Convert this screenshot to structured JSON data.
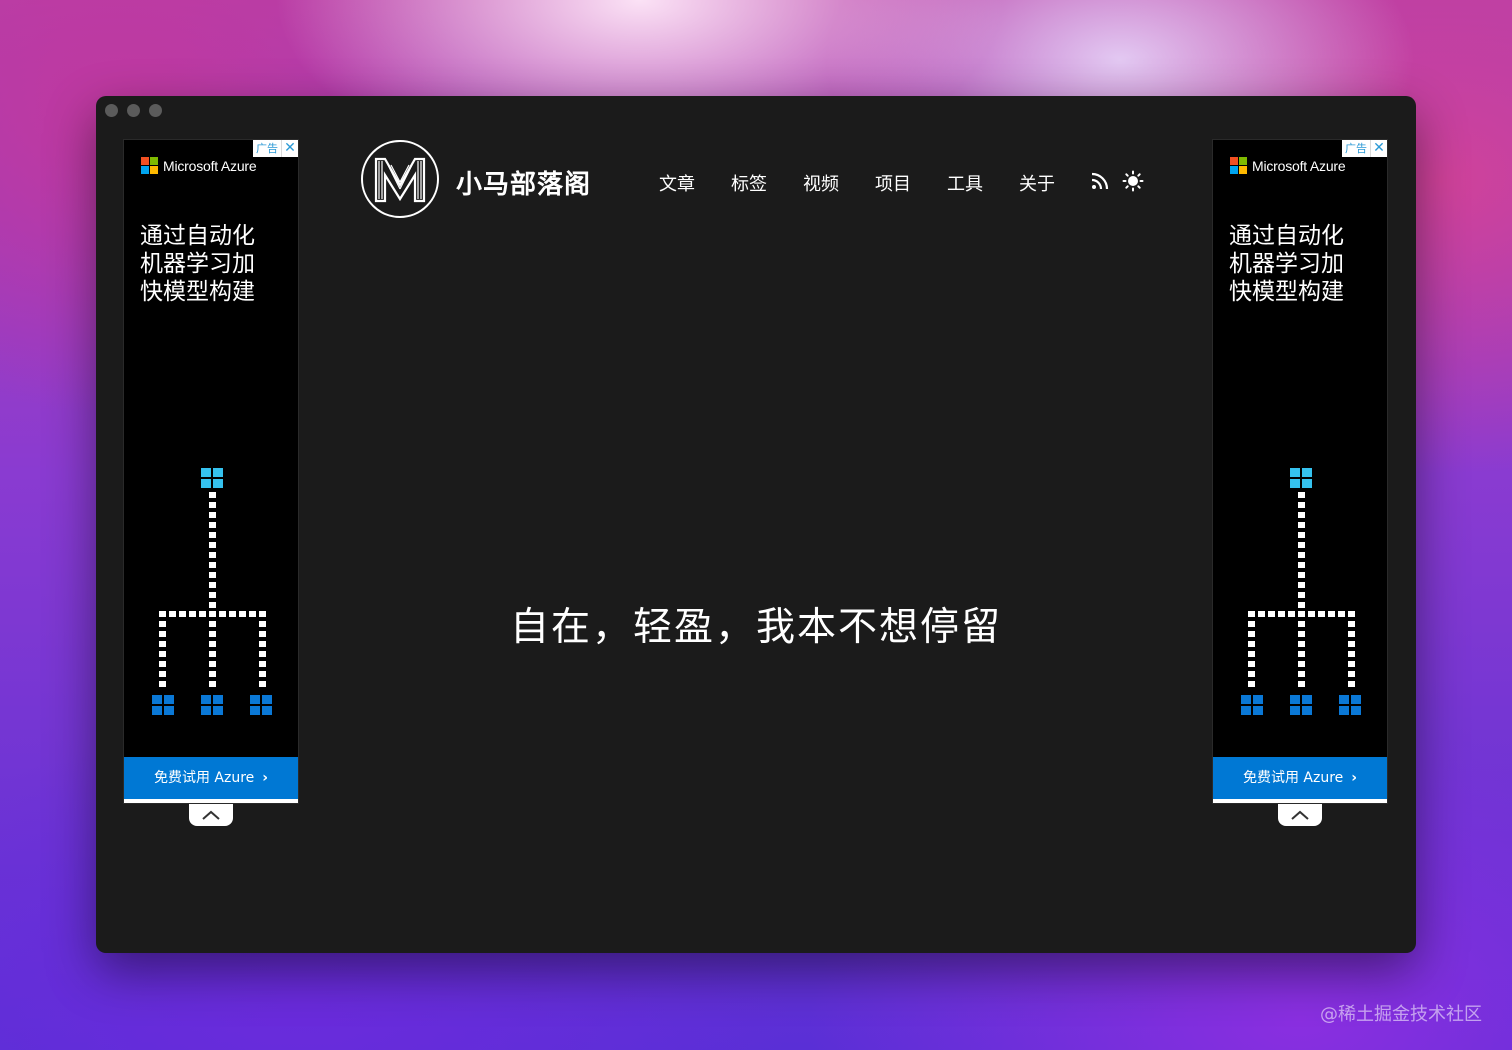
{
  "site": {
    "title": "小马部落阁",
    "tagline": "自在，轻盈，我本不想停留"
  },
  "nav": {
    "items": [
      {
        "label": "文章"
      },
      {
        "label": "标签"
      },
      {
        "label": "视频"
      },
      {
        "label": "项目"
      },
      {
        "label": "工具"
      },
      {
        "label": "关于"
      }
    ],
    "icons": [
      "rss-icon",
      "sun-icon"
    ]
  },
  "ads": {
    "badge_label": "广告",
    "brand": "Microsoft Azure",
    "headline_lines": [
      "通过自动化",
      "机器学习加",
      "快模型构建"
    ],
    "cta": "免费试用 Azure",
    "colors": {
      "cta": "#0078d4",
      "node_top": "#35c2ef",
      "node_bottom": "#0a78d6"
    }
  },
  "watermark": "@稀土掘金技术社区"
}
